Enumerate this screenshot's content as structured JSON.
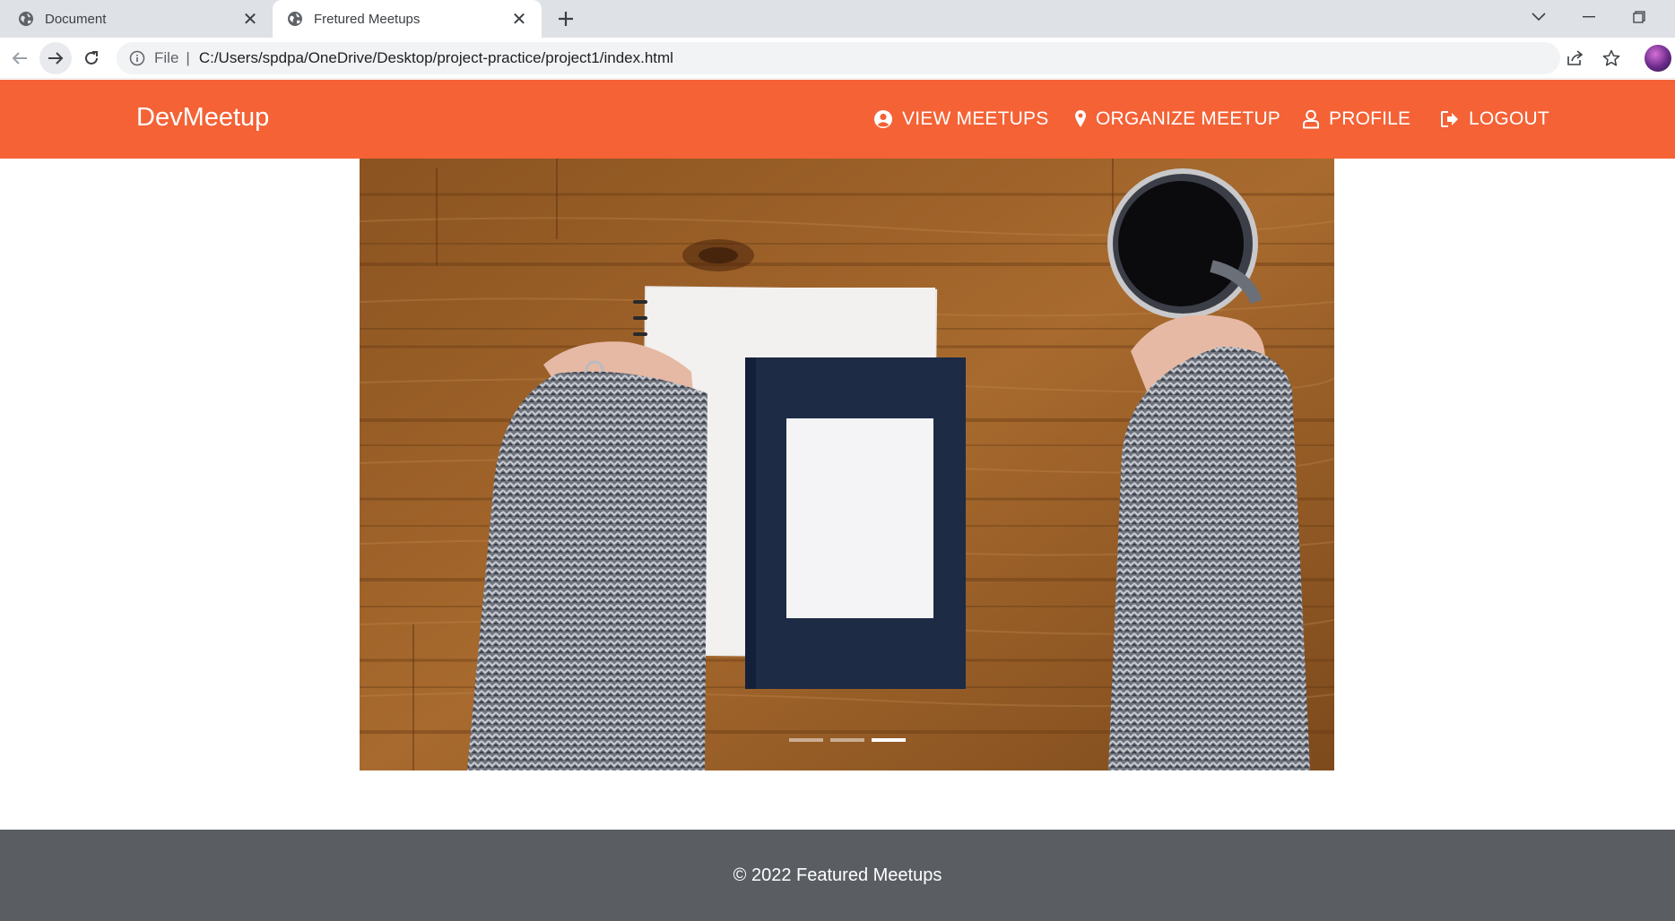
{
  "browser": {
    "tabs": [
      {
        "title": "Document",
        "active": false
      },
      {
        "title": "Fretured Meetups",
        "active": true
      }
    ],
    "address": {
      "scheme_label": "File",
      "url": "C:/Users/spdpa/OneDrive/Desktop/project-practice/project1/index.html"
    }
  },
  "navbar": {
    "brand": "DevMeetup",
    "color": "#f46236",
    "items": [
      {
        "label": "VIEW MEETUPS",
        "icon": "user-circle-icon"
      },
      {
        "label": "ORGANIZE MEETUP",
        "icon": "map-pin-icon"
      },
      {
        "label": "PROFILE",
        "icon": "user-outline-icon"
      },
      {
        "label": "LOGOUT",
        "icon": "logout-icon"
      }
    ]
  },
  "carousel": {
    "slide_count": 3,
    "active_index": 2
  },
  "footer": {
    "text": "© 2022 Featured Meetups",
    "color": "#5a5e63"
  }
}
